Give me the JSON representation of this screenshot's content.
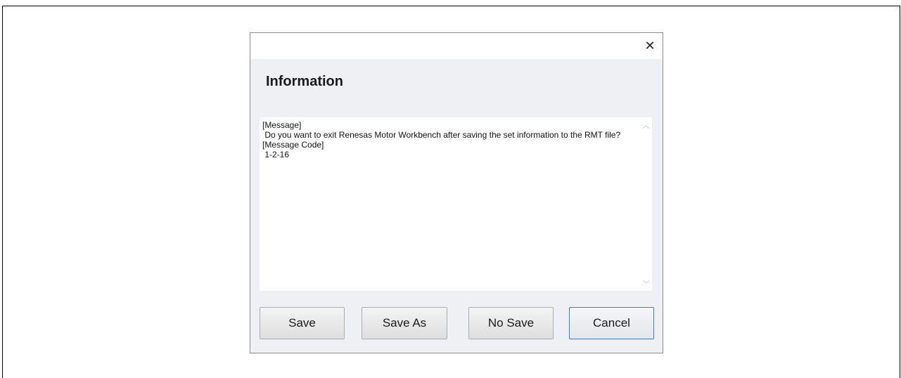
{
  "dialog": {
    "heading": "Information",
    "close_glyph": "✕",
    "message_lines": [
      "[Message]",
      " Do you want to exit Renesas Motor Workbench after saving the set information to the RMT file?",
      "[Message Code]",
      " 1-2-16"
    ],
    "buttons": {
      "save": "Save",
      "save_as": "Save As",
      "no_save": "No Save",
      "cancel": "Cancel"
    }
  },
  "icons": {
    "close": "close-icon",
    "scroll_up": "chevron-up-icon",
    "scroll_down": "chevron-down-icon"
  },
  "colors": {
    "dialog_bg": "#eef0f3",
    "default_button_border": "#3c7fb1"
  }
}
